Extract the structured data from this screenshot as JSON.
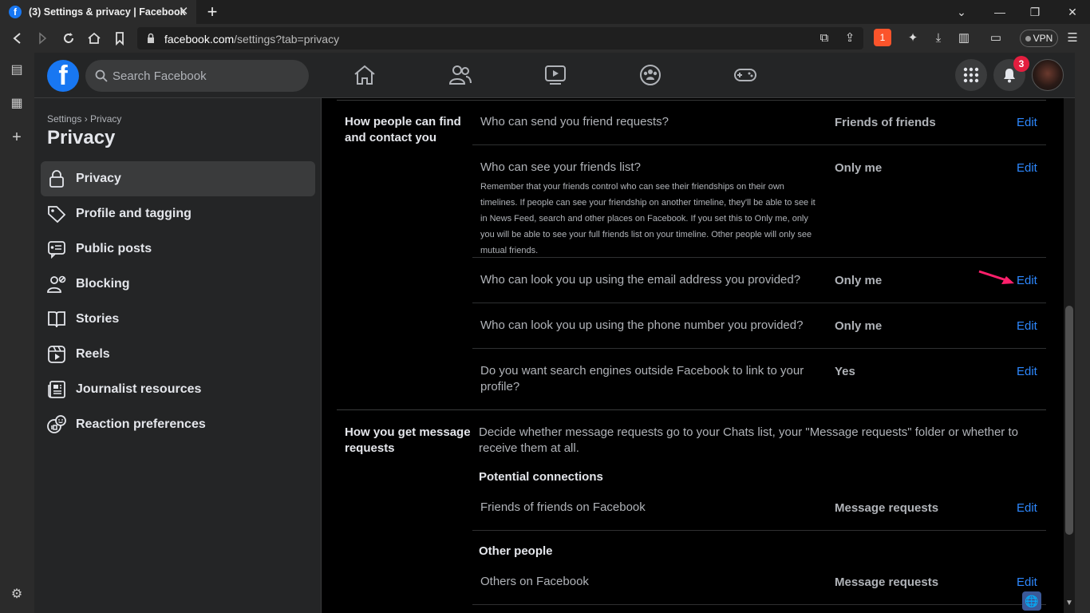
{
  "browser": {
    "tab_title": "(3) Settings & privacy | Facebook",
    "favicon_letter": "f",
    "url_host": "facebook.com",
    "url_path": "/settings?tab=privacy",
    "vpn_label": "VPN",
    "brave_badge": "1"
  },
  "fb_header": {
    "logo_letter": "f",
    "search_placeholder": "Search Facebook",
    "notification_count": "3"
  },
  "settings": {
    "breadcrumb": "Settings › Privacy",
    "title": "Privacy",
    "menu": [
      {
        "label": "Privacy",
        "icon": "lock-icon",
        "active": true
      },
      {
        "label": "Profile and tagging",
        "icon": "tag-icon"
      },
      {
        "label": "Public posts",
        "icon": "public-posts-icon"
      },
      {
        "label": "Blocking",
        "icon": "blocking-icon"
      },
      {
        "label": "Stories",
        "icon": "book-icon"
      },
      {
        "label": "Reels",
        "icon": "reels-icon"
      },
      {
        "label": "Journalist resources",
        "icon": "news-icon"
      },
      {
        "label": "Reaction preferences",
        "icon": "reaction-icon"
      }
    ]
  },
  "find_contact": {
    "title": "How people can find and contact you",
    "rows": [
      {
        "question": "Who can send you friend requests?",
        "value": "Friends of friends",
        "edit": "Edit"
      },
      {
        "question": "Who can see your friends list?",
        "value": "Only me",
        "edit": "Edit",
        "description": "Remember that your friends control who can see their friendships on their own timelines. If people can see your friendship on another timeline, they'll be able to see it in News Feed, search and other places on Facebook. If you set this to Only me, only you will be able to see your full friends list on your timeline. Other people will only see mutual friends."
      },
      {
        "question": "Who can look you up using the email address you provided?",
        "value": "Only me",
        "edit": "Edit"
      },
      {
        "question": "Who can look you up using the phone number you provided?",
        "value": "Only me",
        "edit": "Edit"
      },
      {
        "question": "Do you want search engines outside Facebook to link to your profile?",
        "value": "Yes",
        "edit": "Edit"
      }
    ]
  },
  "message_requests": {
    "title": "How you get message requests",
    "description": "Decide whether message requests go to your Chats list, your \"Message requests\" folder or whether to receive them at all.",
    "potential_heading": "Potential connections",
    "potential_row": {
      "label": "Friends of friends on Facebook",
      "value": "Message requests",
      "edit": "Edit"
    },
    "other_heading": "Other people",
    "other_row": {
      "label": "Others on Facebook",
      "value": "Message requests",
      "edit": "Edit"
    }
  },
  "colors": {
    "accent": "#2d88ff",
    "brand": "#1877f2",
    "annotation_arrow": "#ff1f6b",
    "badge": "#e41e3f"
  }
}
